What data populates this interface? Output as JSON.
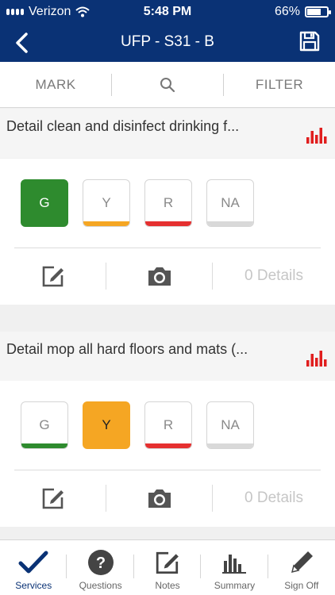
{
  "status": {
    "carrier": "Verizon",
    "time": "5:48 PM",
    "battery": "66%",
    "battery_level": 0.66
  },
  "nav": {
    "title": "UFP - S31 - B"
  },
  "toolbar": {
    "mark": "MARK",
    "filter": "FILTER"
  },
  "colors": {
    "brand": "#0a3275",
    "green": "#2e8b2e",
    "yellow": "#f5a623",
    "red": "#e53030",
    "grey": "#d9d9d9",
    "chart_red": "#e01e1e"
  },
  "tasks": [
    {
      "title": "Detail clean and disinfect drinking f...",
      "ratings": [
        "G",
        "Y",
        "R",
        "NA"
      ],
      "selected": "G",
      "details": "0 Details"
    },
    {
      "title": "Detail mop all hard floors and mats (...",
      "ratings": [
        "G",
        "Y",
        "R",
        "NA"
      ],
      "selected": "Y",
      "details": "0 Details"
    }
  ],
  "tabs": [
    {
      "label": "Services",
      "icon": "checkmark-icon"
    },
    {
      "label": "Questions",
      "icon": "question-icon"
    },
    {
      "label": "Notes",
      "icon": "notes-icon"
    },
    {
      "label": "Summary",
      "icon": "summary-chart-icon"
    },
    {
      "label": "Sign Off",
      "icon": "pencil-icon"
    }
  ]
}
